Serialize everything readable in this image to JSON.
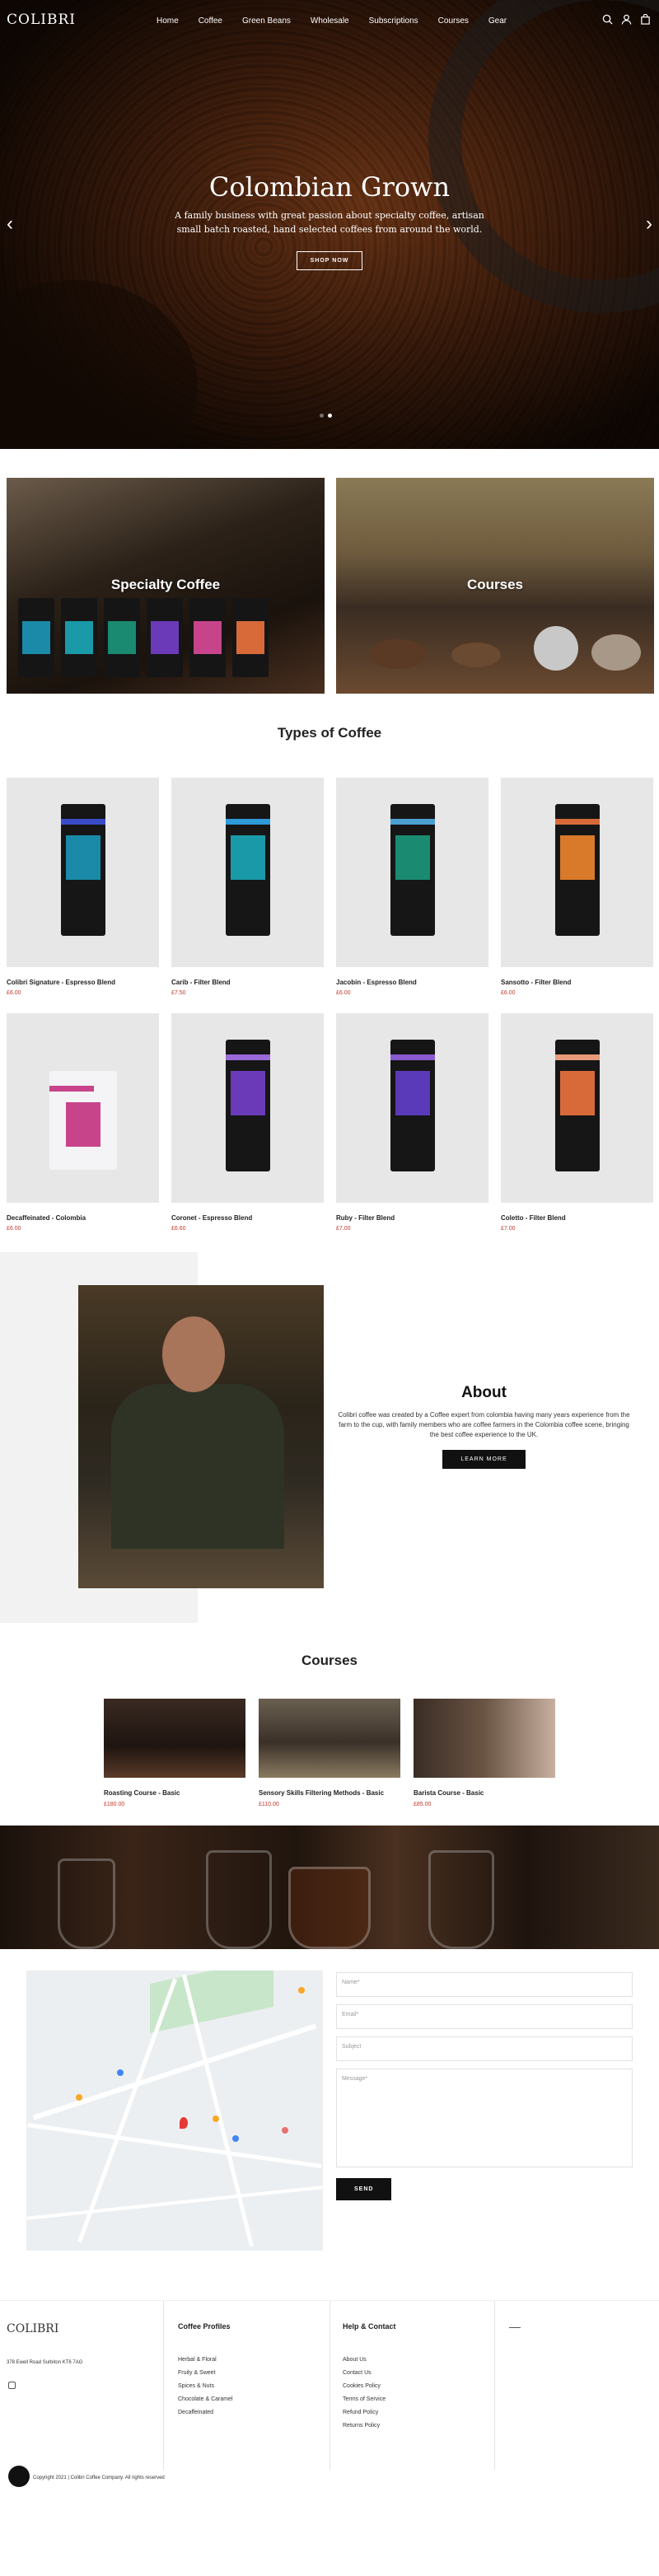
{
  "nav": {
    "logo": "COLIBRI",
    "links": [
      "Home",
      "Coffee",
      "Green Beans",
      "Wholesale",
      "Subscriptions",
      "Courses",
      "Gear"
    ]
  },
  "hero": {
    "title": "Colombian Grown",
    "subtitle": "A family business with great passion about specialty coffee, artisan small batch roasted, hand selected coffees from around the world.",
    "button": "SHOP NOW",
    "slide_count": 2,
    "active_slide": 1
  },
  "banners": {
    "specialty": "Specialty Coffee",
    "courses": "Courses"
  },
  "types_title": "Types of Coffee",
  "products": [
    {
      "name": "Colibri Signature - Espresso Blend",
      "price": "£6.00",
      "strip": "#3a4bc8",
      "label": "#1a8aa8"
    },
    {
      "name": "Carib - Filter Blend",
      "price": "£7.50",
      "strip": "#2e9ad8",
      "label": "#1a9aa8"
    },
    {
      "name": "Jacobin - Espresso Blend",
      "price": "£6.00",
      "strip": "#4aa0d0",
      "label": "#1a8a70"
    },
    {
      "name": "Sansotto - Filter Blend",
      "price": "£6.00",
      "strip": "#d86a3a",
      "label": "#d87a2a"
    },
    {
      "name": "Decaffeinated - Colombia",
      "price": "£6.00",
      "strip": "#c8448a",
      "label": "#c8448a"
    },
    {
      "name": "Coronet - Espresso Blend",
      "price": "£6.60",
      "strip": "#9a6ad8",
      "label": "#6a3ab8"
    },
    {
      "name": "Ruby - Filter Blend",
      "price": "£7.00",
      "strip": "#8a5ad0",
      "label": "#5a3ab8"
    },
    {
      "name": "Coletto - Filter Blend",
      "price": "£7.00",
      "strip": "#e89a7a",
      "label": "#d86a3a"
    }
  ],
  "about": {
    "title": "About",
    "description": "Colibri coffee was created by a Coffee expert from colombia having many years experience from the farm to the cup, with family members who are coffee farmers in the Colombia coffee scene, bringing the best coffee experience to the UK.",
    "button": "LEARN MORE"
  },
  "courses_title": "Courses",
  "courses": [
    {
      "name": "Roasting Course - Basic",
      "price": "£180.00"
    },
    {
      "name": "Sensory Skills Filtering Methods - Basic",
      "price": "£110.00"
    },
    {
      "name": "Barista Course - Basic",
      "price": "£85.00"
    }
  ],
  "contact": {
    "name_placeholder": "Name*",
    "email_placeholder": "Email*",
    "subject_placeholder": "Subject",
    "message_placeholder": "Message*",
    "send": "SEND"
  },
  "footer": {
    "logo": "COLIBRI",
    "address": "378 Ewell Road Surbiton KT6 7AG",
    "profiles_title": "Coffee Profiles",
    "profiles": [
      "Herbal & Floral",
      "Fruity & Sweet",
      "Spices & Nuts",
      "Chocolate & Caramel",
      "Decaffeinated"
    ],
    "help_title": "Help & Contact",
    "help": [
      "About Us",
      "Contact Us",
      "Cookies Policy",
      "Terms of Service",
      "Refund Policy",
      "Returns Policy"
    ],
    "copyright": "Copyright 2021 | Colibri Coffee Company. All rights reserved"
  }
}
